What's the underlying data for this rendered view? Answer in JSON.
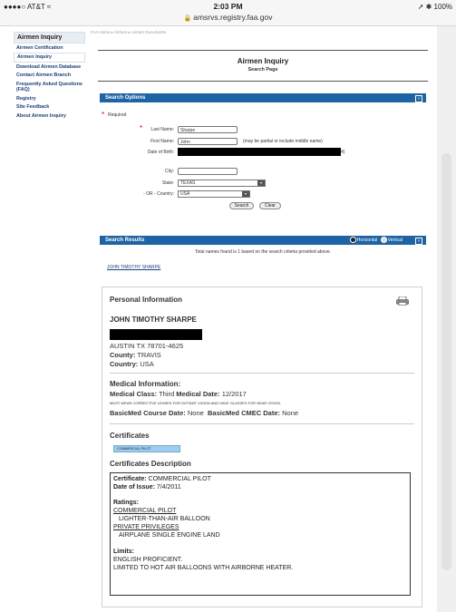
{
  "status_bar": {
    "carrier": "●●●●○ AT&T ≈",
    "time": "2:03 PM",
    "battery": "➚ ✱ 100%"
  },
  "url_bar": {
    "url": "amsrvs.registry.faa.gov"
  },
  "breadcrumb": "FAA Home ▸ Airmen ▸ Airmen Documents",
  "sidebar": {
    "title": "Airmen Inquiry",
    "items": [
      "Airmen Certification",
      "Airmen Inquiry",
      "Download Airmen Database",
      "Contact Airmen Branch",
      "Frequently Asked Questions (FAQ)",
      "Registry",
      "Site Feedback",
      "About Airmen Inquiry"
    ]
  },
  "header": {
    "title": "Airmen Inquiry",
    "subtitle": "Search Page"
  },
  "search_options": {
    "title": "Search Options",
    "required_label": "Required",
    "last_name_label": "Last Name:",
    "last_name_value": "Sharpe",
    "first_name_label": "First Name:",
    "first_name_value": "John",
    "first_name_hint": "(may be partial or include middle name)",
    "dob_label": "Date of Birth:",
    "dob_tail": "4)",
    "city_label": "City:",
    "city_value": "",
    "state_label": "State:",
    "state_value": "TEXAS",
    "country_label": "- OR - Country:",
    "country_value": "USA",
    "search_button": "Search",
    "clear_button": "Clear"
  },
  "search_results": {
    "title": "Search Results",
    "horizontal": "Horizontal",
    "vertical": "Vertical",
    "total_text": "Total names found is 1 based on the search criteria provided above.",
    "result_link": "JOHN TIMOTHY  SHARPE"
  },
  "personal": {
    "heading": "Personal Information",
    "name": "JOHN TIMOTHY SHARPE",
    "city_line": "AUSTIN TX 78701-4625",
    "county_label": "County:",
    "county_value": "TRAVIS",
    "country_label": "Country:",
    "country_value": "USA"
  },
  "medical": {
    "heading": "Medical Information:",
    "class_label": "Medical Class:",
    "class_value": "Third",
    "date_label": "Medical Date:",
    "date_value": "12/2017",
    "limitation": "MUST WEAR CORRECTIVE LENSES FOR DISTANT VISION AND HAVE GLASSES FOR NEAR VISION.",
    "basicmed_course_label": "BasicMed Course Date:",
    "basicmed_course_value": "None",
    "basicmed_cmec_label": "BasicMed CMEC Date:",
    "basicmed_cmec_value": "None"
  },
  "certificates": {
    "heading": "Certificates",
    "pill": "COMMERCIAL PILOT",
    "desc_heading": "Certificates Description",
    "cert_label": "Certificate:",
    "cert_value": "COMMERCIAL PILOT",
    "issue_label": "Date of Issue:",
    "issue_value": "7/4/2011",
    "ratings_label": "Ratings:",
    "rating1_title": "COMMERCIAL PILOT",
    "rating1_value": "LIGHTER-THAN-AIR BALLOON",
    "rating2_title": "PRIVATE PRIVILEGES",
    "rating2_value": "AIRPLANE SINGLE ENGINE LAND",
    "limits_label": "Limits:",
    "limit1": "ENGLISH PROFICIENT.",
    "limit2": "LIMITED TO HOT AIR BALLOONS WITH AIRBORNE HEATER."
  },
  "colors": {
    "accent": "#1e63a4",
    "pill": "#9dcdf2",
    "link": "#1a3f7a"
  },
  "icons": [
    "lock-icon",
    "printer-icon",
    "help-icon",
    "dropdown-arrow-icon"
  ]
}
